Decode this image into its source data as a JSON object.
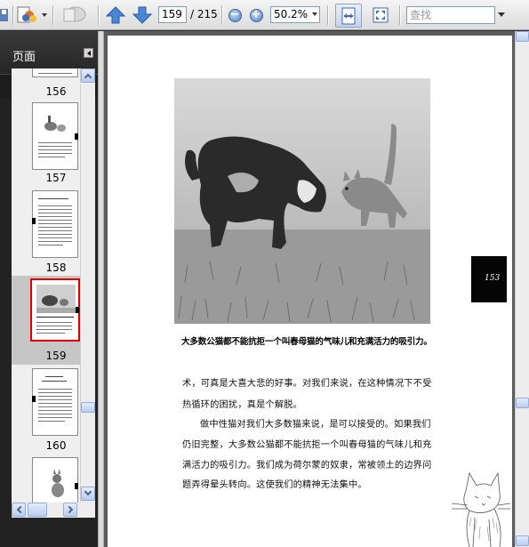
{
  "toolbar": {
    "page_number": "159",
    "page_total": "/ 215",
    "zoom": "50.2%",
    "search_placeholder": "查找",
    "icons": [
      "save-icon",
      "sign-icon",
      "review-icon",
      "previous-page-icon",
      "next-page-icon",
      "zoom-out-icon",
      "zoom-in-icon",
      "fit-width-icon",
      "full-screen-icon"
    ]
  },
  "sidebar": {
    "title": "页面",
    "thumbnails": [
      {
        "label": "156"
      },
      {
        "label": "157"
      },
      {
        "label": "158"
      },
      {
        "label": "159",
        "selected": true
      },
      {
        "label": "160"
      }
    ]
  },
  "document": {
    "caption": "大多数公猫都不能抗拒一个叫春母猫的气味儿和充满活力的吸引力。",
    "paragraphs": [
      "术，可真是大喜大悲的好事。对我们来说，在这种情况下不受",
      "热循环的困扰，真是个解脱。",
      "做中性猫对我们大多数猫来说，是可以接受的。如果我们",
      "仍旧完整，大多数公猫都不能抗拒一个叫春母猫的气味儿和充",
      "满活力的吸引力。我们成为荷尔蒙的奴隶，常被领土的边界问",
      "题弄得晕头转向。这使我们的精神无法集中。"
    ],
    "page_marker": "153"
  },
  "colors": {
    "panel_bg": "#222222",
    "thumb_selected_border": "#e00000",
    "accent_blue": "#3b74c4"
  }
}
